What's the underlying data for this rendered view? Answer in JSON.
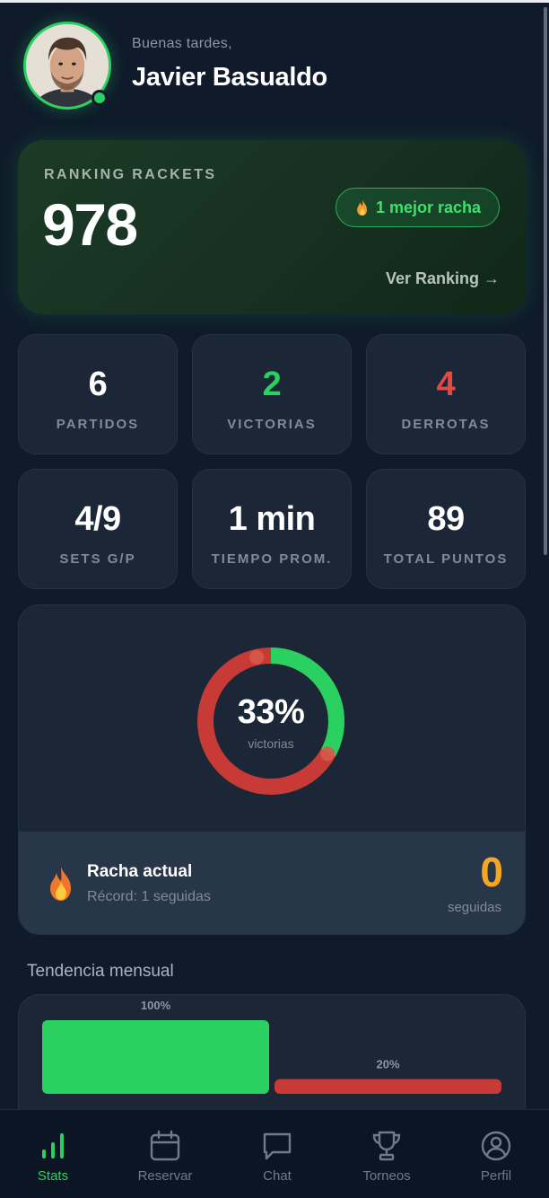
{
  "header": {
    "greeting": "Buenas tardes,",
    "name": "Javier Basualdo"
  },
  "ranking": {
    "label": "RANKING RACKETS",
    "value": "978",
    "streak_badge": "1 mejor racha",
    "link": "Ver Ranking →"
  },
  "stats": [
    {
      "value": "6",
      "label": "PARTIDOS",
      "color": "#ffffff"
    },
    {
      "value": "2",
      "label": "VICTORIAS",
      "color": "#2bd160"
    },
    {
      "value": "4",
      "label": "DERROTAS",
      "color": "#e8483f"
    },
    {
      "value": "4/9",
      "label": "SETS G/P",
      "color": "#ffffff"
    },
    {
      "value": "1 min",
      "label": "TIEMPO PROM.",
      "color": "#ffffff"
    },
    {
      "value": "89",
      "label": "TOTAL PUNTOS",
      "color": "#ffffff"
    }
  ],
  "win_rate": {
    "percent_text": "33%",
    "caption": "victorias",
    "win_fraction": 0.33,
    "win_color": "#2bd160",
    "loss_color": "#c83a36"
  },
  "current_streak": {
    "title": "Racha actual",
    "record": "Récord: 1 seguidas",
    "value": "0",
    "unit": "seguidas"
  },
  "trend": {
    "title": "Tendencia mensual",
    "bars": [
      {
        "label": "100%",
        "value": 100,
        "color": "#2bd160"
      },
      {
        "label": "20%",
        "value": 20,
        "color": "#c83a36"
      }
    ]
  },
  "nav": {
    "items": [
      {
        "label": "Stats",
        "icon": "bar-chart-icon",
        "active": true
      },
      {
        "label": "Reservar",
        "icon": "calendar-icon",
        "active": false
      },
      {
        "label": "Chat",
        "icon": "chat-icon",
        "active": false
      },
      {
        "label": "Torneos",
        "icon": "trophy-icon",
        "active": false
      },
      {
        "label": "Perfil",
        "icon": "user-circle-icon",
        "active": false
      }
    ]
  },
  "colors": {
    "background": "#0f1a2a",
    "accent": "#2bd160",
    "loss": "#c83a36",
    "streak": "#f5a623"
  }
}
